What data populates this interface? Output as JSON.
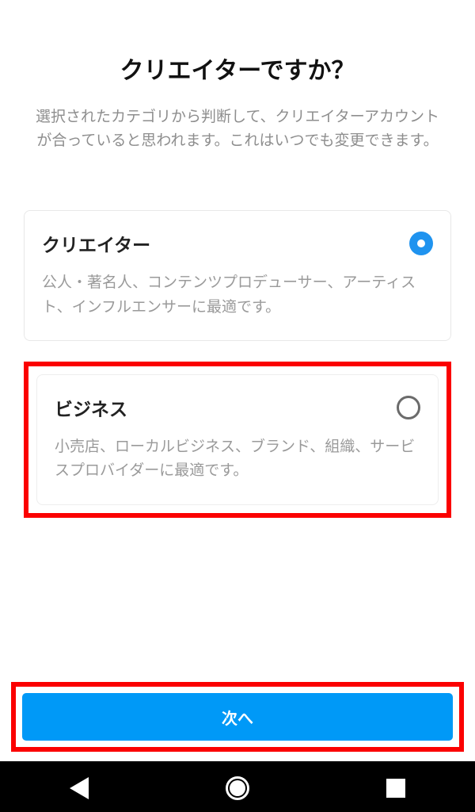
{
  "header": {
    "title": "クリエイターですか？",
    "subtitle": "選択されたカテゴリから判断して、クリエイターアカウントが合っていると思われます。これはいつでも変更できます。"
  },
  "options": [
    {
      "label": "クリエイター",
      "description": "公人・著名人、コンテンツプロデューサー、アーティスト、インフルエンサーに最適です。",
      "selected": true,
      "highlighted": false
    },
    {
      "label": "ビジネス",
      "description": "小売店、ローカルビジネス、ブランド、組織、サービスプロバイダーに最適です。",
      "selected": false,
      "highlighted": true
    }
  ],
  "footer": {
    "next_label": "次へ",
    "next_highlighted": true
  },
  "colors": {
    "accent": "#0099f7",
    "highlight": "#fb0101"
  }
}
